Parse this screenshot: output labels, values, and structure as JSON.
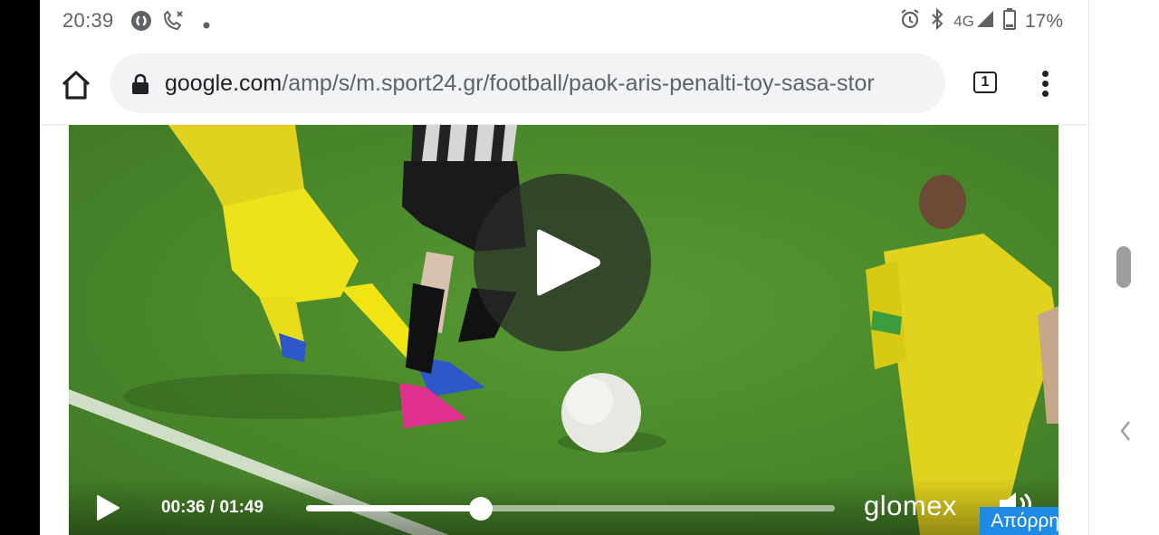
{
  "status_bar": {
    "time": "20:39",
    "left_icons": [
      "shazam-icon",
      "missed-call-icon",
      "notification-dot-icon"
    ],
    "right_icons": [
      "alarm-icon",
      "bluetooth-icon",
      "signal-icon",
      "battery-icon"
    ],
    "network": "4G",
    "battery": "17%"
  },
  "toolbar": {
    "url_host": "google.com",
    "url_path": "/amp/s/m.sport24.gr/football/paok-aris-penalti-toy-sasa-stor",
    "tab_count": "1"
  },
  "video": {
    "current_time": "00:36",
    "separator": " / ",
    "duration": "01:49",
    "progress": 0.33,
    "brand": "glomex",
    "privacy_label": "Απόρρητο"
  },
  "colors": {
    "accent_blue": "#1f8ae3",
    "pitch_green": "#4a8a2b",
    "text_gray": "#5f6368"
  }
}
